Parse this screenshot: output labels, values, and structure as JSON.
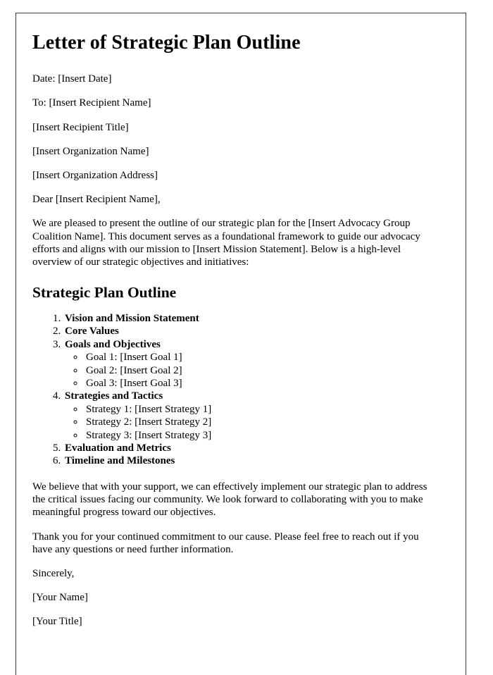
{
  "document": {
    "title": "Letter of Strategic Plan Outline",
    "header_fields": {
      "date_line": "Date: [Insert Date]",
      "to_line": "To: [Insert Recipient Name]",
      "recipient_title": "[Insert Recipient Title]",
      "organization_name": "[Insert Organization Name]",
      "organization_address": "[Insert Organization Address]"
    },
    "salutation": "Dear [Insert Recipient Name],",
    "intro_paragraph": "We are pleased to present the outline of our strategic plan for the [Insert Advocacy Group Coalition Name]. This document serves as a foundational framework to guide our advocacy efforts and aligns with our mission to [Insert Mission Statement]. Below is a high-level overview of our strategic objectives and initiatives:",
    "outline_heading": "Strategic Plan Outline",
    "outline_items": [
      {
        "label": "Vision and Mission Statement",
        "subitems": []
      },
      {
        "label": "Core Values",
        "subitems": []
      },
      {
        "label": "Goals and Objectives",
        "subitems": [
          "Goal 1: [Insert Goal 1]",
          "Goal 2: [Insert Goal 2]",
          "Goal 3: [Insert Goal 3]"
        ]
      },
      {
        "label": "Strategies and Tactics",
        "subitems": [
          "Strategy 1: [Insert Strategy 1]",
          "Strategy 2: [Insert Strategy 2]",
          "Strategy 3: [Insert Strategy 3]"
        ]
      },
      {
        "label": "Evaluation and Metrics",
        "subitems": []
      },
      {
        "label": "Timeline and Milestones",
        "subitems": []
      }
    ],
    "closing_paragraph_1": "We believe that with your support, we can effectively implement our strategic plan to address the critical issues facing our community. We look forward to collaborating with you to make meaningful progress toward our objectives.",
    "closing_paragraph_2": "Thank you for your continued commitment to our cause. Please feel free to reach out if you have any questions or need further information.",
    "signoff": "Sincerely,",
    "signature_name": "[Your Name]",
    "signature_title": "[Your Title]"
  },
  "style": {
    "page_background": "#ffffff",
    "text_color": "#000000",
    "page_border_color": "#3a3a3a"
  }
}
